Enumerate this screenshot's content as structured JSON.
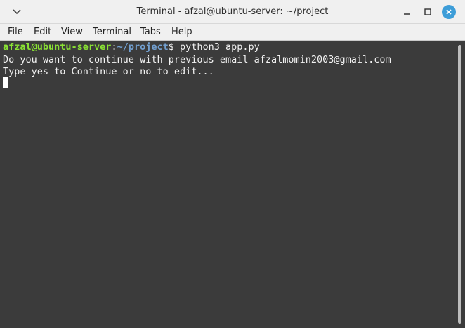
{
  "window": {
    "title": "Terminal - afzal@ubuntu-server: ~/project",
    "icons": {
      "menu": "chevron-down-icon",
      "minimize": "minimize-icon",
      "maximize": "maximize-icon",
      "close": "close-icon"
    },
    "accent_color": "#3d9dd8"
  },
  "menu": {
    "items": [
      {
        "label": "File"
      },
      {
        "label": "Edit"
      },
      {
        "label": "View"
      },
      {
        "label": "Terminal"
      },
      {
        "label": "Tabs"
      },
      {
        "label": "Help"
      }
    ]
  },
  "terminal": {
    "prompt_user": "afzal@ubuntu-server",
    "prompt_colon": ":",
    "prompt_path": "~/project",
    "prompt_symbol": "$",
    "command": " python3 app.py",
    "output": [
      "Do you want to continue with previous email afzalmomin2003@gmail.com",
      "Type yes to Continue or no to edit..."
    ],
    "colors": {
      "background": "#3b3b3b",
      "user": "#8ae234",
      "path": "#729fcf",
      "text": "#f2f2f2"
    }
  }
}
